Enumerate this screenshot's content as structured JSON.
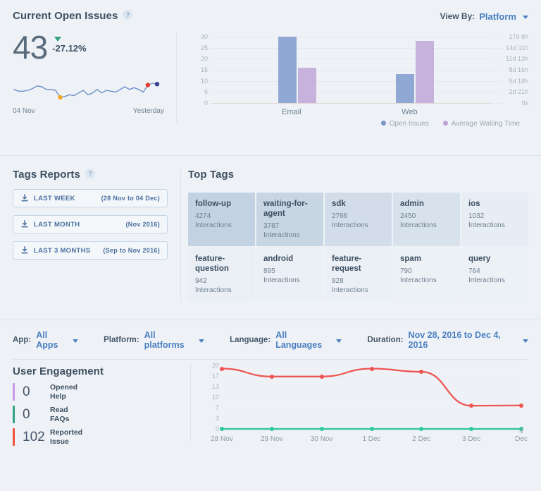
{
  "open_issues": {
    "title": "Current Open Issues",
    "help_icon": "question-mark-icon",
    "view_by_label": "View By:",
    "view_by_value": "Platform",
    "kpi_value": "43",
    "kpi_delta": "-27.12%",
    "trend_direction": "down",
    "trend_color": "#32a37f",
    "spark_start_label": "04 Nov",
    "spark_end_label": "Yesterday"
  },
  "tags_reports": {
    "title": "Tags Reports",
    "help_icon": "question-mark-icon",
    "buttons": [
      {
        "label": "LAST WEEK",
        "range": "(28 Nov to 04 Dec)",
        "icon": "download-icon"
      },
      {
        "label": "LAST MONTH",
        "range": "(Nov 2016)",
        "icon": "download-icon"
      },
      {
        "label": "LAST 3 MONTHS",
        "range": "(Sep to Nov 2016)",
        "icon": "download-icon"
      }
    ]
  },
  "top_tags": {
    "title": "Top Tags",
    "unit": "Interactions",
    "items": [
      {
        "name": "follow-up",
        "count": "4274",
        "shade": "#c3d2e2"
      },
      {
        "name": "waiting-for-agent",
        "count": "3787",
        "shade": "#c8d6e4"
      },
      {
        "name": "sdk",
        "count": "2766",
        "shade": "#d2dde9"
      },
      {
        "name": "admin",
        "count": "2450",
        "shade": "#d8e2ec"
      },
      {
        "name": "ios",
        "count": "1032",
        "shade": "#e7edf4"
      },
      {
        "name": "feature-question",
        "count": "942",
        "shade": "#e9eff5"
      },
      {
        "name": "android",
        "count": "895",
        "shade": "#ebf0f6"
      },
      {
        "name": "feature-request",
        "count": "828",
        "shade": "#ebf0f6"
      },
      {
        "name": "spam",
        "count": "790",
        "shade": "#ecf1f6"
      },
      {
        "name": "query",
        "count": "764",
        "shade": "#ecf1f6"
      }
    ]
  },
  "filters": [
    {
      "key": "App:",
      "value": "All Apps"
    },
    {
      "key": "Platform:",
      "value": "All platforms"
    },
    {
      "key": "Language:",
      "value": "All Languages"
    },
    {
      "key": "Duration:",
      "value": "Nov 28, 2016 to Dec 4, 2016"
    }
  ],
  "user_engagement": {
    "title": "User Engagement",
    "metrics": [
      {
        "value": "0",
        "label": "Opened Help",
        "color": "#c79ae8"
      },
      {
        "value": "0",
        "label": "Read FAQs",
        "color": "#2fa37f"
      },
      {
        "value": "102",
        "label": "Reported Issue",
        "color": "#f0503c"
      }
    ]
  },
  "chart_data": [
    {
      "type": "bar",
      "title": "Current Open Issues by Platform",
      "categories": [
        "Email",
        "Web"
      ],
      "series": [
        {
          "name": "Open Issues",
          "values": [
            30,
            13
          ],
          "color": "#90a9d4",
          "axis": "left"
        },
        {
          "name": "Average Waiting Time",
          "values": [
            16,
            28
          ],
          "color": "#c7b2dd",
          "axis": "right"
        }
      ],
      "ylabel": "",
      "ylim": [
        0,
        30
      ],
      "yticks": [
        30,
        25,
        20,
        15,
        10,
        5,
        0
      ],
      "y2ticks": [
        "17d 8h",
        "14d 11h",
        "11d 13h",
        "8d 16h",
        "5d 18h",
        "2d 21h",
        "0s"
      ],
      "legend_position": "bottom-right",
      "grid": true
    },
    {
      "type": "line",
      "title": "Current Open Issues trend",
      "subtitle": "sparkline",
      "x": [
        "04 Nov",
        "Yesterday"
      ],
      "values": [
        52,
        50,
        50,
        51,
        53,
        56,
        55,
        52,
        52,
        51,
        43,
        44,
        46,
        45,
        48,
        51,
        46,
        48,
        52,
        48,
        51,
        50,
        49,
        52,
        55,
        52,
        54,
        52,
        49,
        57,
        59,
        58
      ],
      "color": "#6f8fc9",
      "markers": [
        {
          "index": 10,
          "color": "#f5a623",
          "label": "minimum"
        },
        {
          "index": 29,
          "color": "#e8382e",
          "label": "latest-high"
        },
        {
          "index": 31,
          "color": "#3d3f96",
          "label": "current"
        }
      ],
      "grid": false
    },
    {
      "type": "line",
      "title": "User Engagement",
      "x": [
        "28 Nov",
        "29 Nov",
        "30 Nov",
        "1 Dec",
        "2 Dec",
        "3 Dec",
        "4 Dec"
      ],
      "series": [
        {
          "name": "Reported Issue",
          "values": [
            19,
            16.5,
            16.5,
            19,
            18,
            7.3,
            7.4
          ],
          "color": "#ef5350"
        },
        {
          "name": "Read FAQs",
          "values": [
            0,
            0,
            0,
            0,
            0,
            0,
            0
          ],
          "color": "#2fc8a0"
        },
        {
          "name": "Opened Help",
          "values": [
            0,
            0,
            0,
            0,
            0,
            0,
            0
          ],
          "color": "#c79ae8"
        }
      ],
      "ylim": [
        0,
        20
      ],
      "yticks": [
        20,
        17,
        13,
        10,
        7,
        3,
        0
      ],
      "grid": true,
      "legend_position": "left-panel"
    }
  ]
}
